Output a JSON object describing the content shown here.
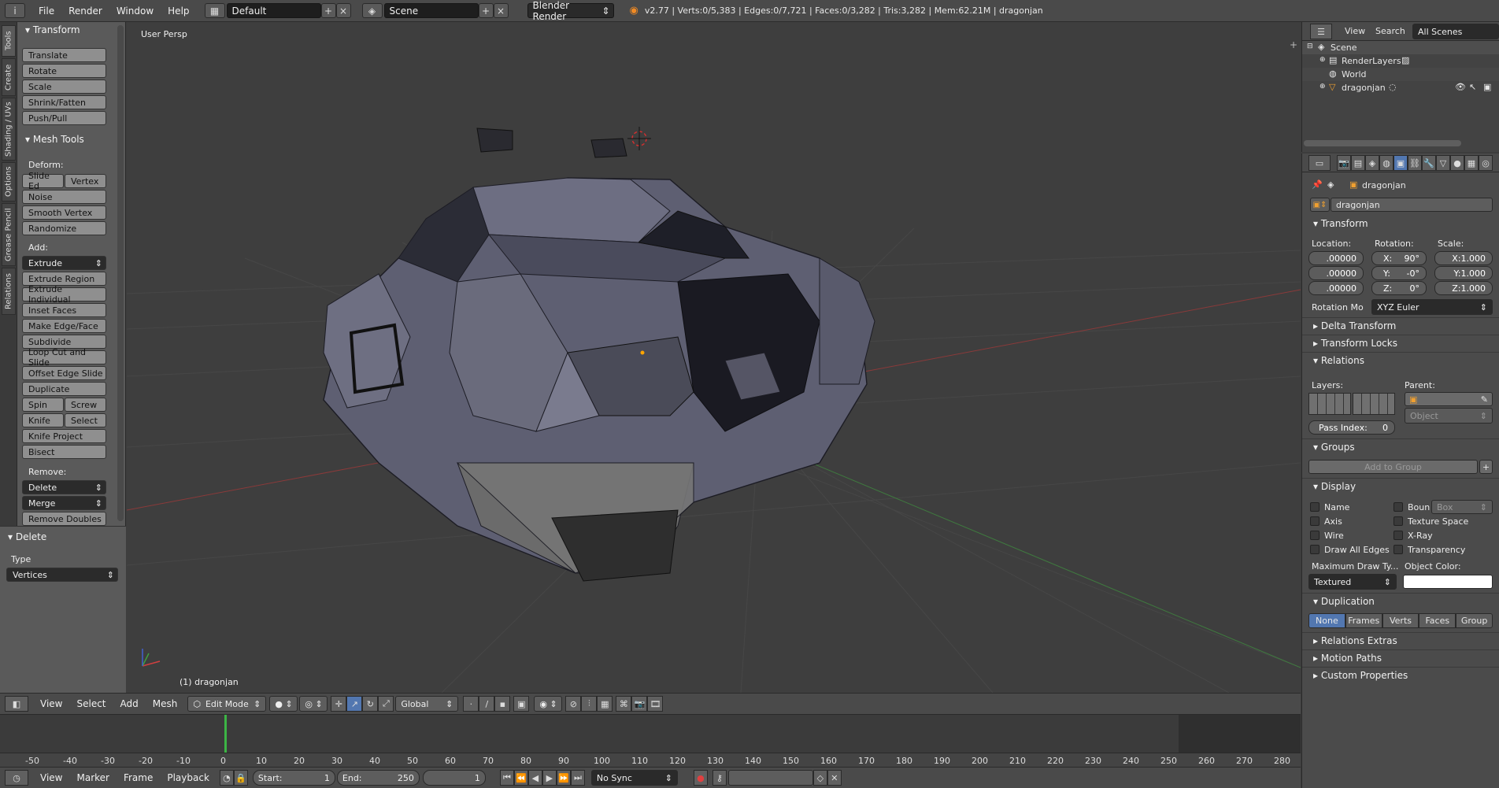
{
  "topbar": {
    "info_icon": "i",
    "menus": [
      "File",
      "Render",
      "Window",
      "Help"
    ],
    "screen_layout": "Default",
    "scene": "Scene",
    "render_engine": "Blender Render",
    "stats": "v2.77 | Verts:0/5,383 | Edges:0/7,721 | Faces:0/3,282 | Tris:3,282 | Mem:62.21M | dragonjan"
  },
  "side_tabs": [
    "Tools",
    "Create",
    "Shading / UVs",
    "Options",
    "Grease Pencil",
    "Relations"
  ],
  "toolshelf": {
    "transform_header": "Transform",
    "transform_buttons": [
      "Translate",
      "Rotate",
      "Scale",
      "Shrink/Fatten",
      "Push/Pull"
    ],
    "mesh_tools_header": "Mesh Tools",
    "deform_label": "Deform:",
    "slide_edge": "Slide Ed",
    "vertex": "Vertex",
    "noise": "Noise",
    "smooth_vertex": "Smooth Vertex",
    "randomize": "Randomize",
    "add_label": "Add:",
    "extrude": "Extrude",
    "add_buttons": [
      "Extrude Region",
      "Extrude Individual",
      "Inset Faces",
      "Make Edge/Face",
      "Subdivide",
      "Loop Cut and Slide",
      "Offset Edge Slide",
      "Duplicate"
    ],
    "spin": "Spin",
    "screw": "Screw",
    "knife": "Knife",
    "select": "Select",
    "knife_project": "Knife Project",
    "bisect": "Bisect",
    "remove_label": "Remove:",
    "delete": "Delete",
    "merge": "Merge",
    "remove_doubles": "Remove Doubles",
    "operator_header": "Delete",
    "type_label": "Type",
    "type_value": "Vertices"
  },
  "viewport": {
    "view_name": "User Persp",
    "object_label": "(1) dragonjan"
  },
  "view3d_header": {
    "menus": [
      "View",
      "Select",
      "Add",
      "Mesh"
    ],
    "mode": "Edit Mode",
    "orientation": "Global"
  },
  "timeline": {
    "ticks": [
      "-50",
      "-40",
      "-30",
      "-20",
      "-10",
      "0",
      "10",
      "20",
      "30",
      "40",
      "50",
      "60",
      "70",
      "80",
      "90",
      "100",
      "110",
      "120",
      "130",
      "140",
      "150",
      "160",
      "170",
      "180",
      "190",
      "200",
      "210",
      "220",
      "230",
      "240",
      "250",
      "260",
      "270",
      "280"
    ],
    "menus": [
      "View",
      "Marker",
      "Frame",
      "Playback"
    ],
    "start_label": "Start:",
    "start_value": "1",
    "end_label": "End:",
    "end_value": "250",
    "current_frame": "1",
    "sync": "No Sync"
  },
  "outliner": {
    "menus": [
      "View",
      "Search"
    ],
    "display_mode": "All Scenes",
    "items": [
      "Scene",
      "RenderLayers",
      "World",
      "dragonjan"
    ]
  },
  "properties": {
    "breadcrumb_object": "dragonjan",
    "object_name": "dragonjan",
    "transform_header": "Transform",
    "location_label": "Location:",
    "rotation_label": "Rotation:",
    "scale_label": "Scale:",
    "location": [
      ".00000",
      ".00000",
      ".00000"
    ],
    "rotation_axes": [
      "X:",
      "Y:",
      "Z:"
    ],
    "rotation": [
      "90°",
      "-0°",
      "0°"
    ],
    "scale": [
      "X:1.000",
      "Y:1.000",
      "Z:1.000"
    ],
    "rotation_mode_label": "Rotation Mo",
    "rotation_mode": "XYZ Euler",
    "delta_transform": "Delta Transform",
    "transform_locks": "Transform Locks",
    "relations": "Relations",
    "layers_label": "Layers:",
    "parent_label": "Parent:",
    "parent_type": "Object",
    "pass_index_label": "Pass Index:",
    "pass_index": "0",
    "groups": "Groups",
    "add_to_group": "Add to Group",
    "display": "Display",
    "display_left": [
      "Name",
      "Axis",
      "Wire",
      "Draw All Edges"
    ],
    "display_right": [
      "Boun",
      "Texture Space",
      "X-Ray",
      "Transparency"
    ],
    "bounds_type": "Box",
    "max_draw_type_label": "Maximum Draw Ty...",
    "object_color_label": "Object Color:",
    "max_draw_type": "Textured",
    "duplication": "Duplication",
    "dup_options": [
      "None",
      "Frames",
      "Verts",
      "Faces",
      "Group"
    ],
    "relations_extras": "Relations Extras",
    "motion_paths": "Motion Paths",
    "custom_properties": "Custom Properties"
  }
}
